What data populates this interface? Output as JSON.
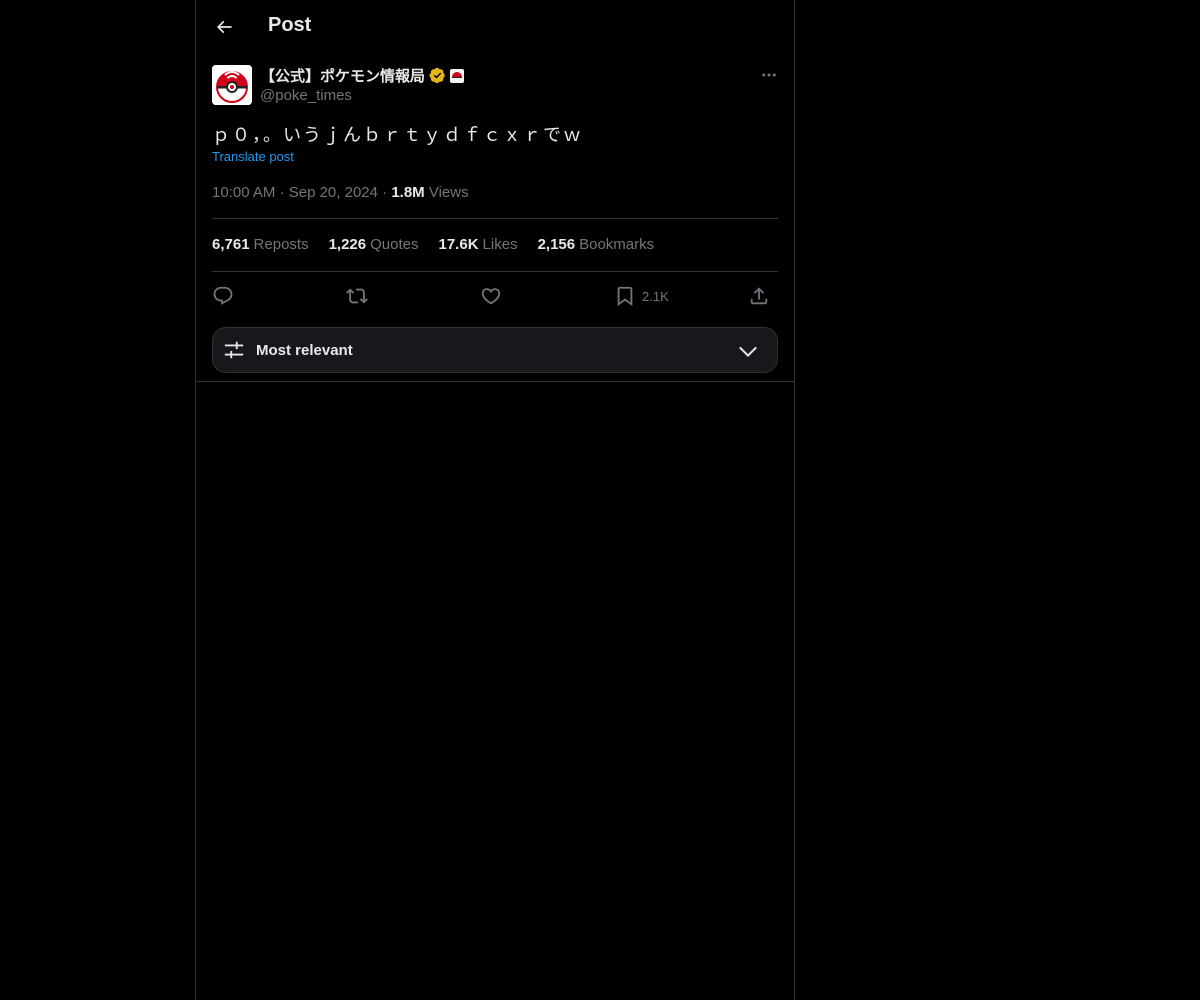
{
  "header": {
    "title": "Post",
    "back_icon": "arrow-left-icon"
  },
  "post": {
    "author_name": "【公式】ポケモン情報局",
    "verified_badge": "gold-verified-icon",
    "affiliate_badge": "affiliate-badge-icon",
    "handle": "@poke_times",
    "text": "ｐ０，。いうｊんｂｒｔｙｄｆｃｘｒでｗ",
    "translate_label": "Translate post",
    "time": "10:00 AM",
    "date": "Sep 20, 2024",
    "views_count": "1.8M",
    "views_label": "Views"
  },
  "stats": [
    {
      "count": "6,761",
      "label": "Reposts"
    },
    {
      "count": "1,226",
      "label": "Quotes"
    },
    {
      "count": "17.6K",
      "label": "Likes"
    },
    {
      "count": "2,156",
      "label": "Bookmarks"
    }
  ],
  "actions": {
    "reply_icon": "reply-icon",
    "repost_icon": "repost-icon",
    "like_icon": "heart-icon",
    "bookmark_icon": "bookmark-icon",
    "bookmark_count": "2.1K",
    "share_icon": "share-icon"
  },
  "sort": {
    "label": "Most relevant",
    "icon": "sliders-icon",
    "chevron": "chevron-down-icon"
  },
  "colors": {
    "background": "#000000",
    "accent": "#1d9bf0",
    "muted": "#71767b",
    "border": "#2f3336",
    "verified_gold": "#e2b719"
  }
}
